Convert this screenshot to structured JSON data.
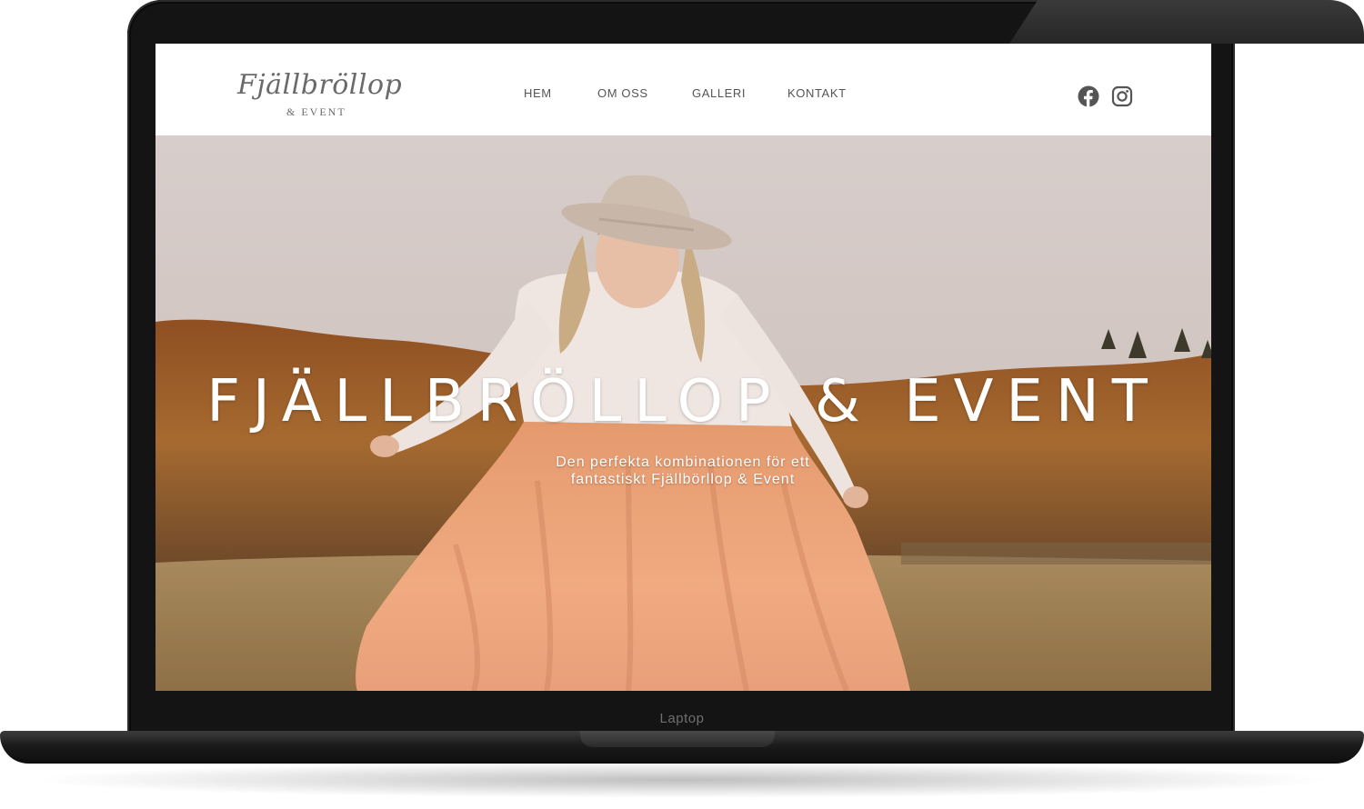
{
  "device": {
    "label": "Laptop"
  },
  "logo": {
    "script": "Fjällbröllop",
    "sub": "& EVENT"
  },
  "nav": {
    "items": [
      {
        "label": "HEM"
      },
      {
        "label": "OM OSS"
      },
      {
        "label": "GALLERI"
      },
      {
        "label": "KONTAKT"
      }
    ]
  },
  "social": {
    "icons": [
      "facebook-icon",
      "instagram-icon"
    ],
    "icon_color": "#555555"
  },
  "hero": {
    "title": "FJÄLLBRÖLLOP & EVENT",
    "subtitle_line1": "Den perfekta kombinationen för ett",
    "subtitle_line2": "fantastiskt Fjällbörllop & Event"
  },
  "colors": {
    "frame": "#141414",
    "header_bg": "#ffffff",
    "nav_text": "#555555",
    "hero_text": "#ffffff",
    "skirt": "#e9a07a"
  }
}
